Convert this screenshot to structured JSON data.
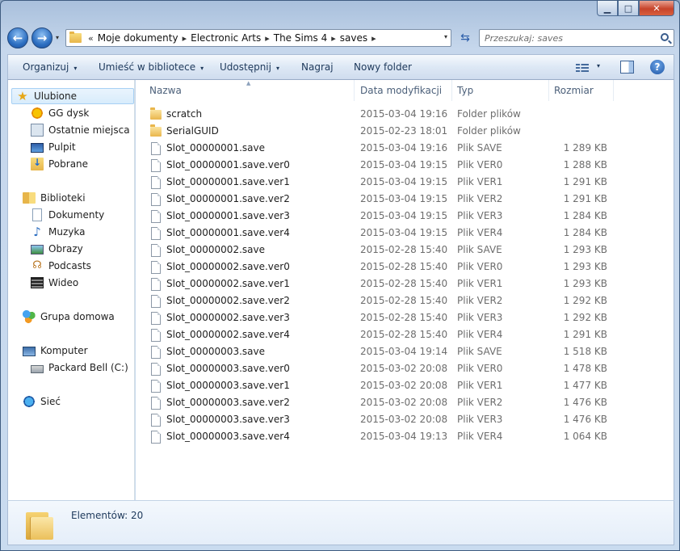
{
  "nav": {
    "back_glyph": "←",
    "forward_glyph": "→",
    "dropdown_glyph": "▾",
    "breadcrumb_overflow": "«",
    "breadcrumb_separator": "▸",
    "breadcrumbs": [
      "Moje dokumenty",
      "Electronic Arts",
      "The Sims 4",
      "saves"
    ],
    "refresh_glyph": "⇆",
    "search_placeholder": "Przeszukaj: saves"
  },
  "toolbar": {
    "organize": "Organizuj",
    "include_in_library": "Umieść w bibliotece",
    "share": "Udostępnij",
    "burn": "Nagraj",
    "new_folder": "Nowy folder",
    "dropdown_glyph": "▾",
    "help_glyph": "?"
  },
  "sidebar": {
    "favorites": {
      "label": "Ulubione",
      "items": [
        "GG dysk",
        "Ostatnie miejsca",
        "Pulpit",
        "Pobrane"
      ]
    },
    "libraries": {
      "label": "Biblioteki",
      "items": [
        "Dokumenty",
        "Muzyka",
        "Obrazy",
        "Podcasts",
        "Wideo"
      ]
    },
    "homegroup": "Grupa domowa",
    "computer": {
      "label": "Komputer",
      "items": [
        "Packard Bell (C:)"
      ]
    },
    "network": "Sieć"
  },
  "columns": {
    "name": "Nazwa",
    "modified": "Data modyfikacji",
    "type": "Typ",
    "size": "Rozmiar",
    "sort_glyph": "▲"
  },
  "files": [
    {
      "name": "scratch",
      "modified": "2015-03-04 19:16",
      "type": "Folder plików",
      "size": "",
      "icon": "folder-icon"
    },
    {
      "name": "SerialGUID",
      "modified": "2015-02-23 18:01",
      "type": "Folder plików",
      "size": "",
      "icon": "folder-icon"
    },
    {
      "name": "Slot_00000001.save",
      "modified": "2015-03-04 19:16",
      "type": "Plik SAVE",
      "size": "1 289 KB",
      "icon": "file-icon"
    },
    {
      "name": "Slot_00000001.save.ver0",
      "modified": "2015-03-04 19:15",
      "type": "Plik VER0",
      "size": "1 288 KB",
      "icon": "file-icon"
    },
    {
      "name": "Slot_00000001.save.ver1",
      "modified": "2015-03-04 19:15",
      "type": "Plik VER1",
      "size": "1 291 KB",
      "icon": "file-icon"
    },
    {
      "name": "Slot_00000001.save.ver2",
      "modified": "2015-03-04 19:15",
      "type": "Plik VER2",
      "size": "1 291 KB",
      "icon": "file-icon"
    },
    {
      "name": "Slot_00000001.save.ver3",
      "modified": "2015-03-04 19:15",
      "type": "Plik VER3",
      "size": "1 284 KB",
      "icon": "file-icon"
    },
    {
      "name": "Slot_00000001.save.ver4",
      "modified": "2015-03-04 19:15",
      "type": "Plik VER4",
      "size": "1 284 KB",
      "icon": "file-icon"
    },
    {
      "name": "Slot_00000002.save",
      "modified": "2015-02-28 15:40",
      "type": "Plik SAVE",
      "size": "1 293 KB",
      "icon": "file-icon"
    },
    {
      "name": "Slot_00000002.save.ver0",
      "modified": "2015-02-28 15:40",
      "type": "Plik VER0",
      "size": "1 293 KB",
      "icon": "file-icon"
    },
    {
      "name": "Slot_00000002.save.ver1",
      "modified": "2015-02-28 15:40",
      "type": "Plik VER1",
      "size": "1 293 KB",
      "icon": "file-icon"
    },
    {
      "name": "Slot_00000002.save.ver2",
      "modified": "2015-02-28 15:40",
      "type": "Plik VER2",
      "size": "1 292 KB",
      "icon": "file-icon"
    },
    {
      "name": "Slot_00000002.save.ver3",
      "modified": "2015-02-28 15:40",
      "type": "Plik VER3",
      "size": "1 292 KB",
      "icon": "file-icon"
    },
    {
      "name": "Slot_00000002.save.ver4",
      "modified": "2015-02-28 15:40",
      "type": "Plik VER4",
      "size": "1 291 KB",
      "icon": "file-icon"
    },
    {
      "name": "Slot_00000003.save",
      "modified": "2015-03-04 19:14",
      "type": "Plik SAVE",
      "size": "1 518 KB",
      "icon": "file-icon"
    },
    {
      "name": "Slot_00000003.save.ver0",
      "modified": "2015-03-02 20:08",
      "type": "Plik VER0",
      "size": "1 478 KB",
      "icon": "file-icon"
    },
    {
      "name": "Slot_00000003.save.ver1",
      "modified": "2015-03-02 20:08",
      "type": "Plik VER1",
      "size": "1 477 KB",
      "icon": "file-icon"
    },
    {
      "name": "Slot_00000003.save.ver2",
      "modified": "2015-03-02 20:08",
      "type": "Plik VER2",
      "size": "1 476 KB",
      "icon": "file-icon"
    },
    {
      "name": "Slot_00000003.save.ver3",
      "modified": "2015-03-02 20:08",
      "type": "Plik VER3",
      "size": "1 476 KB",
      "icon": "file-icon"
    },
    {
      "name": "Slot_00000003.save.ver4",
      "modified": "2015-03-04 19:13",
      "type": "Plik VER4",
      "size": "1 064 KB",
      "icon": "file-icon"
    }
  ],
  "status": {
    "item_count": "Elementów: 20"
  }
}
